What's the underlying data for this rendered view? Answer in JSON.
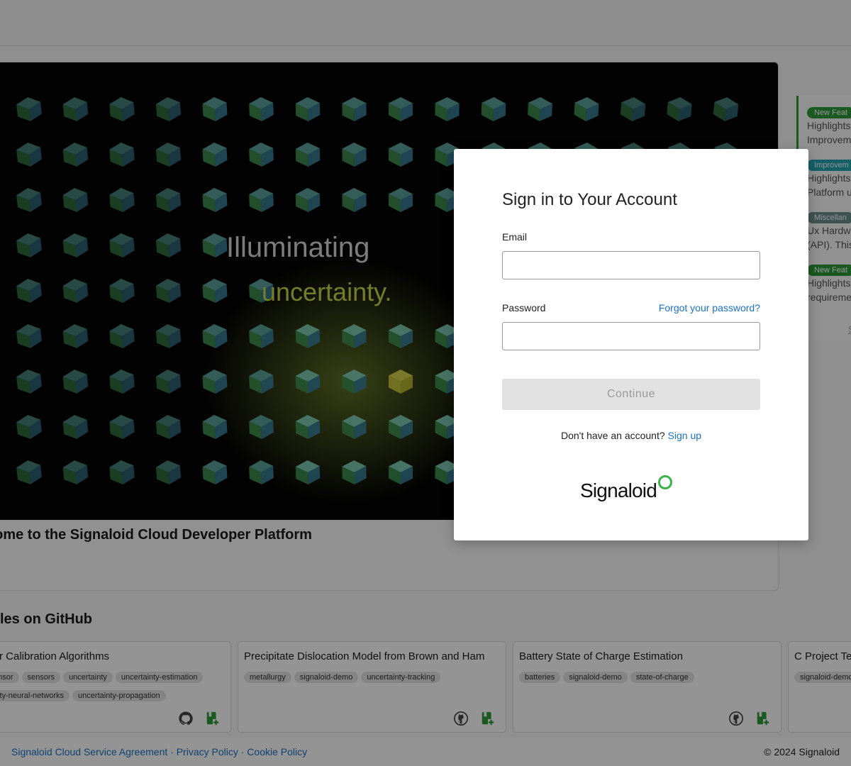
{
  "hero": {
    "image_line1": "Illuminating",
    "image_line2": "uncertainty.",
    "title": "come to the Signaloid Cloud Developer Platform"
  },
  "news": {
    "items": [
      {
        "badge": "New Feat",
        "line1": "Highlights",
        "line2": "Improvem",
        "color": "#2e9a3a"
      },
      {
        "badge": "Improvem",
        "line1": "Highlights",
        "line2": "Platform u",
        "color": "#23a6b0"
      },
      {
        "badge": "Miscellan",
        "line1": "Ux Hardw",
        "line2": "(API). This",
        "color": "#6e8f8f"
      },
      {
        "badge": "New Feat",
        "line1": "Highlights",
        "line2": "requireme",
        "color": "#2e9a3a"
      }
    ],
    "more_link": "S"
  },
  "github": {
    "section_title": "les on GitHub",
    "repos": [
      {
        "title": "r Calibration Algorithms",
        "tags": [
          "ensor",
          "sensors",
          "uncertainty",
          "uncertainty-estimation",
          "inty-neural-networks",
          "uncertainty-propagation"
        ]
      },
      {
        "title": "Precipitate Dislocation Model from Brown and Ham",
        "tags": [
          "metallurgy",
          "signaloid-demo",
          "uncertainty-tracking"
        ]
      },
      {
        "title": "Battery State of Charge Estimation",
        "tags": [
          "batteries",
          "signaloid-demo",
          "state-of-charge"
        ]
      },
      {
        "title": "C Project Te",
        "tags": [
          "signaloid-demo"
        ]
      }
    ]
  },
  "footer": {
    "agreement": "Signaloid Cloud Service Agreement",
    "privacy": "Privacy Policy",
    "cookie": "Cookie Policy",
    "separator": "·",
    "copyright": "© 2024 Signaloid"
  },
  "signin": {
    "title": "Sign in to Your Account",
    "email_label": "Email",
    "email_value": "",
    "password_label": "Password",
    "password_value": "",
    "forgot_link": "Forgot your password?",
    "continue_label": "Continue",
    "no_account_text": "Don't have an account?",
    "signup_link": "Sign up",
    "logo_text": "Signaloid",
    "logo_ring_color": "#3bb34a"
  },
  "colors": {
    "accent_link": "#1a73c8",
    "brand_green": "#2e9a3a",
    "image_highlight": "#c8d84a"
  }
}
